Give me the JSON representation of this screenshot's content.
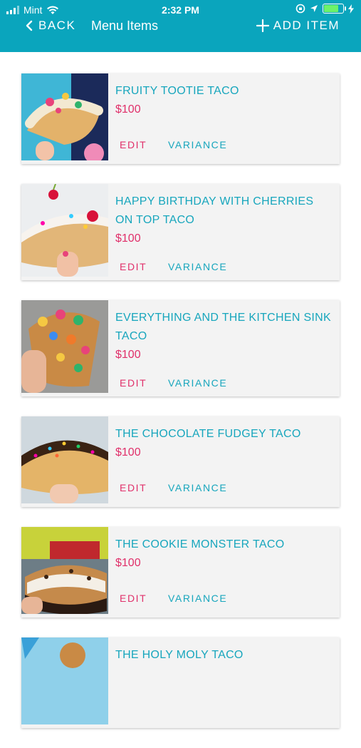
{
  "status_bar": {
    "carrier": "Mint",
    "time": "2:32 PM"
  },
  "nav": {
    "back_label": "BACK",
    "title": "Menu Items",
    "add_label": "ADD ITEM"
  },
  "colors": {
    "header": "#0aa5bd",
    "accent_pink": "#e0306a",
    "accent_teal": "#17a6bd"
  },
  "items": [
    {
      "name": "FRUITY TOOTIE TACO",
      "price": "$100",
      "edit": "EDIT",
      "variance": "VARIANCE"
    },
    {
      "name": "HAPPY BIRTHDAY WITH CHERRIES ON TOP TACO",
      "price": "$100",
      "edit": "EDIT",
      "variance": "VARIANCE"
    },
    {
      "name": "EVERYTHING AND THE KITCHEN SINK TACO",
      "price": "$100",
      "edit": "EDIT",
      "variance": "VARIANCE"
    },
    {
      "name": "THE CHOCOLATE FUDGEY TACO",
      "price": "$100",
      "edit": "EDIT",
      "variance": "VARIANCE"
    },
    {
      "name": "THE COOKIE MONSTER TACO",
      "price": "$100",
      "edit": "EDIT",
      "variance": "VARIANCE"
    },
    {
      "name": "THE HOLY MOLY TACO",
      "price": "",
      "edit": "",
      "variance": ""
    }
  ]
}
